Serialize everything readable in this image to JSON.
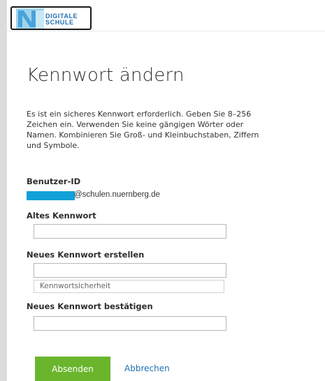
{
  "header": {
    "logo_line1": "DIGITALE",
    "logo_line2": "SCHULE"
  },
  "form": {
    "title": "Kennwort ändern",
    "description": "Es ist ein sicheres Kennwort erforderlich. Geben Sie 8–256 Zeichen ein. Verwenden Sie keine gängigen Wörter oder Namen. Kombinieren Sie Groß- und Kleinbuchstaben, Ziffern und Symbole.",
    "user_id_label": "Benutzer-ID",
    "user_id_domain": "@schulen.nuernberg.de",
    "old_password_label": "Altes Kennwort",
    "new_password_label": "Neues Kennwort erstellen",
    "strength_label": "Kennwortsicherheit",
    "confirm_password_label": "Neues Kennwort bestätigen",
    "submit_label": "Absenden",
    "cancel_label": "Abbrechen"
  },
  "colors": {
    "accent_green": "#6ab52c",
    "link_blue": "#1f6fb5",
    "redaction_blue": "#12a0d8"
  }
}
